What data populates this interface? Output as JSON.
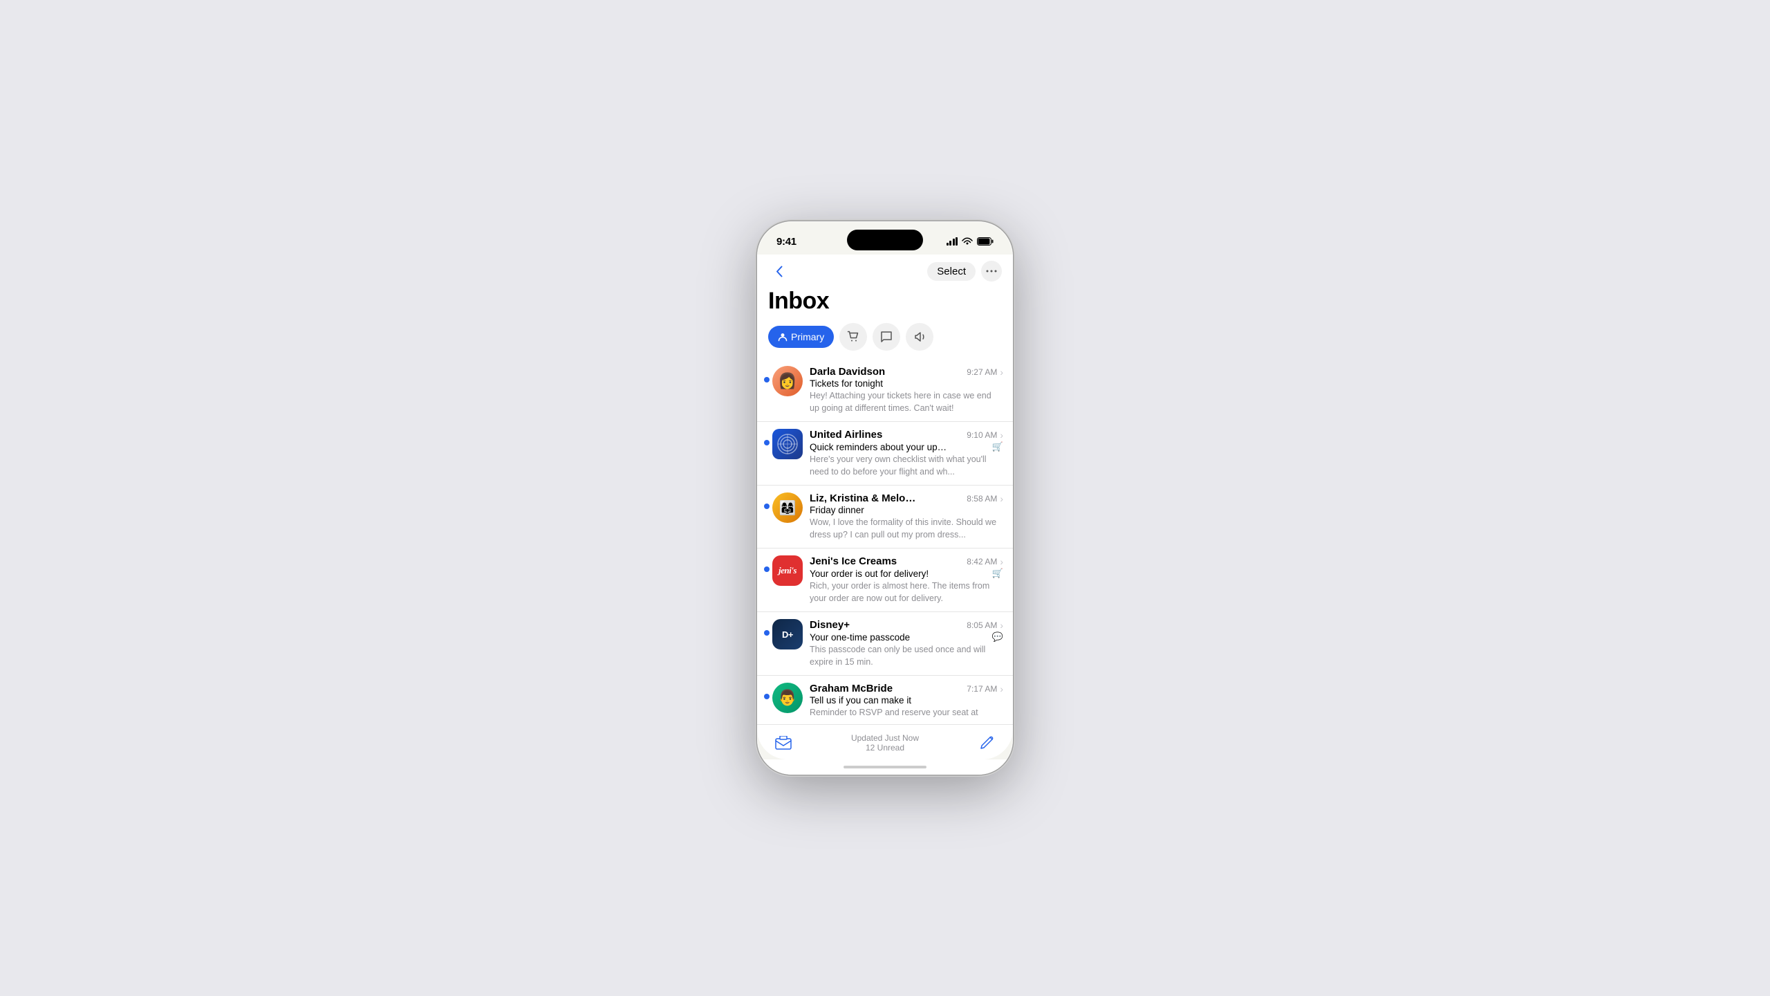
{
  "status_bar": {
    "time": "9:41",
    "signal_label": "signal",
    "wifi_label": "wifi",
    "battery_label": "battery"
  },
  "nav": {
    "back_label": "‹",
    "select_label": "Select",
    "more_label": "•••"
  },
  "inbox": {
    "title": "Inbox"
  },
  "tabs": [
    {
      "id": "primary",
      "label": "Primary",
      "icon": "person",
      "active": true
    },
    {
      "id": "shopping",
      "label": "",
      "icon": "cart",
      "active": false
    },
    {
      "id": "social",
      "label": "",
      "icon": "bubble",
      "active": false
    },
    {
      "id": "promos",
      "label": "",
      "icon": "megaphone",
      "active": false
    }
  ],
  "emails": [
    {
      "sender": "Darla Davidson",
      "subject": "Tickets for tonight",
      "preview": "Hey! Attaching your tickets here in case we end up going at different times. Can't wait!",
      "time": "9:27 AM",
      "unread": true,
      "avatar_type": "emoji",
      "avatar_emoji": "👩",
      "avatar_class": "avatar-darla",
      "category_icon": ""
    },
    {
      "sender": "United Airlines",
      "subject": "Quick reminders about your upcoming...",
      "preview": "Here's your very own checklist with what you'll need to do before your flight and wh...",
      "time": "9:10 AM",
      "unread": true,
      "avatar_type": "emoji",
      "avatar_emoji": "✈",
      "avatar_class": "avatar-united",
      "category_icon": "🛒"
    },
    {
      "sender": "Liz, Kristina & Melody",
      "subject": "Friday dinner",
      "preview": "Wow, I love the formality of this invite. Should we dress up? I can pull out my prom dress...",
      "time": "8:58 AM",
      "unread": true,
      "avatar_type": "emoji",
      "avatar_emoji": "👩‍👩‍👧",
      "avatar_class": "avatar-liz",
      "category_icon": ""
    },
    {
      "sender": "Jeni's Ice Creams",
      "subject": "Your order is out for delivery!",
      "preview": "Rich, your order is almost here. The items from your order are now out for delivery.",
      "time": "8:42 AM",
      "unread": true,
      "avatar_type": "text",
      "avatar_text": "jeni's",
      "avatar_class": "avatar-jenis",
      "category_icon": "🛒"
    },
    {
      "sender": "Disney+",
      "subject": "Your one-time passcode",
      "preview": "This passcode can only be used once and will expire in 15 min.",
      "time": "8:05 AM",
      "unread": true,
      "avatar_type": "text",
      "avatar_text": "D+",
      "avatar_class": "avatar-disney",
      "category_icon": "💬"
    },
    {
      "sender": "Graham McBride",
      "subject": "Tell us if you can make it",
      "preview": "Reminder to RSVP and reserve your seat at",
      "time": "7:17 AM",
      "unread": true,
      "avatar_type": "emoji",
      "avatar_emoji": "👨",
      "avatar_class": "avatar-graham",
      "category_icon": ""
    }
  ],
  "bottom_bar": {
    "updated_label": "Updated Just Now",
    "unread_label": "12 Unread",
    "mailbox_icon": "mailbox",
    "compose_icon": "compose"
  }
}
